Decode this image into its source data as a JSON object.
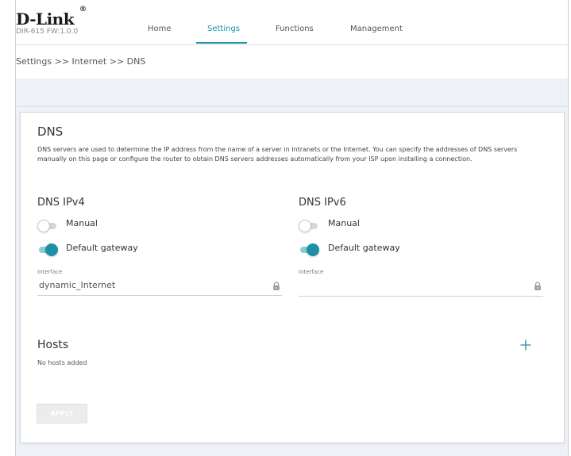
{
  "header": {
    "logo": "D-Link",
    "logo_mark": "®",
    "model": "DIR-615 FW:1.0.0"
  },
  "nav": {
    "home": "Home",
    "settings": "Settings",
    "functions": "Functions",
    "management": "Management",
    "active": "Settings",
    "accent_color": "#1f8fa6"
  },
  "breadcrumb": "Settings >> Internet >> DNS",
  "dns": {
    "title": "DNS",
    "description": "DNS servers are used to determine the IP address from the name of a server in Intranets or the Internet. You can specify the addresses of DNS servers manually on this page or configure the router to obtain DNS servers addresses automatically from your ISP upon installing a connection."
  },
  "ipv4": {
    "title": "DNS IPv4",
    "manual_label": "Manual",
    "manual_on": false,
    "gateway_label": "Default gateway",
    "gateway_on": true,
    "interface_label": "Interface",
    "interface_value": "dynamic_Internet",
    "lock_icon": "lock-icon"
  },
  "ipv6": {
    "title": "DNS IPv6",
    "manual_label": "Manual",
    "manual_on": false,
    "gateway_label": "Default gateway",
    "gateway_on": true,
    "interface_label": "Interface",
    "interface_value": "",
    "lock_icon": "lock-icon"
  },
  "hosts": {
    "title": "Hosts",
    "empty": "No hosts added",
    "add_icon": "plus-icon"
  },
  "apply_label": "APPLY"
}
